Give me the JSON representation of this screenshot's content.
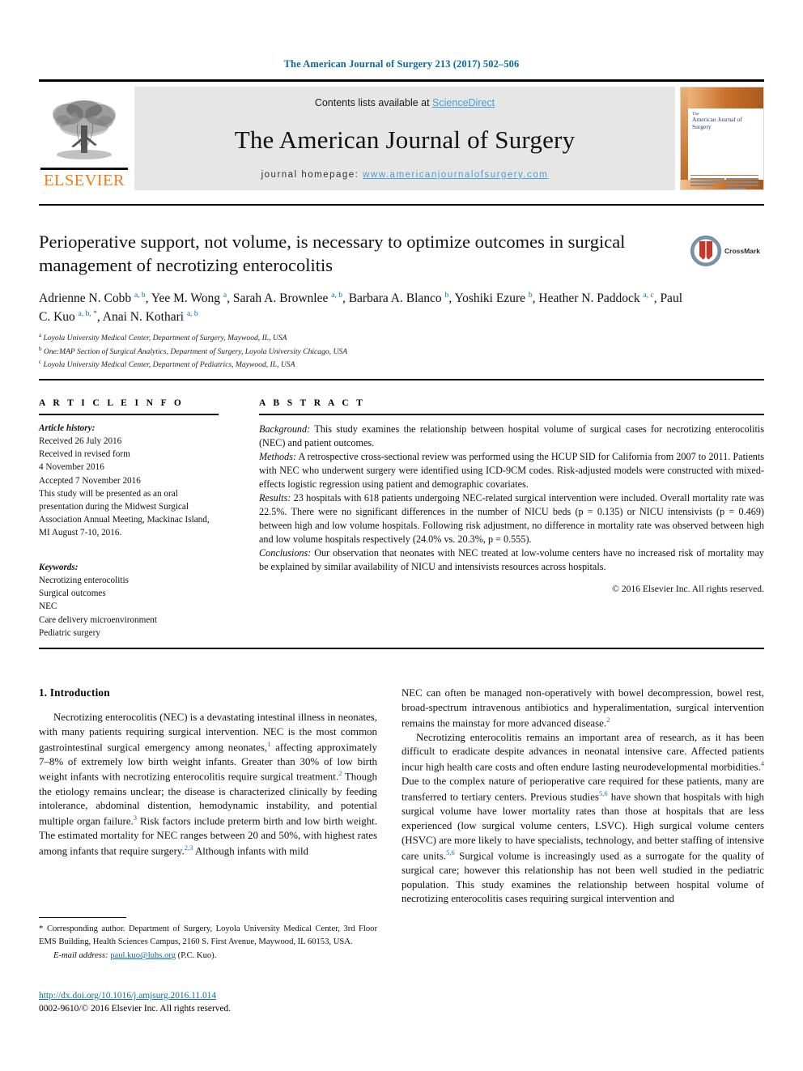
{
  "running_head": "The American Journal of Surgery 213 (2017) 502–506",
  "masthead": {
    "publisher": "ELSEVIER",
    "contents_prefix": "Contents lists available at ",
    "contents_link": "ScienceDirect",
    "journal_title": "The American Journal of Surgery",
    "homepage_prefix": "journal homepage: ",
    "homepage_url": "www.americanjournalofsurgery.com",
    "cover_title_small": "The",
    "cover_title": "American Journal of Surgery"
  },
  "article": {
    "title": "Perioperative support, not volume, is necessary to optimize outcomes in surgical management of necrotizing enterocolitis",
    "authors_html": "Adrienne N. Cobb <sup>a, b</sup>, Yee M. Wong <sup>a</sup>, Sarah A. Brownlee <sup>a, b</sup>, Barbara A. Blanco <sup>b</sup>, Yoshiki Ezure <sup>b</sup>, Heather N. Paddock <sup>a, c</sup>, Paul C. Kuo <sup>a, b, *</sup>, Anai N. Kothari <sup>a, b</sup>",
    "affiliations": [
      {
        "marker": "a",
        "text": "Loyola University Medical Center, Department of Surgery, Maywood, IL, USA"
      },
      {
        "marker": "b",
        "text": "One:MAP Section of Surgical Analytics, Department of Surgery, Loyola University Chicago, USA"
      },
      {
        "marker": "c",
        "text": "Loyola University Medical Center, Department of Pediatrics, Maywood, IL, USA"
      }
    ],
    "crossmark_label": "CrossMark"
  },
  "article_info": {
    "heading": "A R T I C L E  I N F O",
    "history_label": "Article history:",
    "history_lines": [
      "Received 26 July 2016",
      "Received in revised form",
      "4 November 2016",
      "Accepted 7 November 2016",
      "This study will be presented as an oral presentation during the Midwest Surgical Association Annual Meeting, Mackinac Island, MI August 7-10, 2016."
    ],
    "keywords_label": "Keywords:",
    "keywords": [
      "Necrotizing enterocolitis",
      "Surgical outcomes",
      "NEC",
      "Care delivery microenvironment",
      "Pediatric surgery"
    ]
  },
  "abstract": {
    "heading": "A B S T R A C T",
    "sections": [
      {
        "label": "Background:",
        "text": " This study examines the relationship between hospital volume of surgical cases for necrotizing enterocolitis (NEC) and patient outcomes."
      },
      {
        "label": "Methods:",
        "text": " A retrospective cross-sectional review was performed using the HCUP SID for California from 2007 to 2011. Patients with NEC who underwent surgery were identified using ICD-9CM codes. Risk-adjusted models were constructed with mixed-effects logistic regression using patient and demographic covariates."
      },
      {
        "label": "Results:",
        "text": " 23 hospitals with 618 patients undergoing NEC-related surgical intervention were included. Overall mortality rate was 22.5%. There were no significant differences in the number of NICU beds (p = 0.135) or NICU intensivists (p = 0.469) between high and low volume hospitals. Following risk adjustment, no difference in mortality rate was observed between high and low volume hospitals respectively (24.0% vs. 20.3%, p = 0.555)."
      },
      {
        "label": "Conclusions:",
        "text": " Our observation that neonates with NEC treated at low-volume centers have no increased risk of mortality may be explained by similar availability of NICU and intensivists resources across hospitals."
      }
    ],
    "copyright": "© 2016 Elsevier Inc. All rights reserved."
  },
  "body": {
    "section_heading": "1. Introduction",
    "left_paragraphs_html": [
      "Necrotizing enterocolitis (NEC) is a devastating intestinal illness in neonates, with many patients requiring surgical intervention. NEC is the most common gastrointestinal surgical emergency among neonates,<sup>1</sup> affecting approximately 7–8% of extremely low birth weight infants. Greater than 30% of low birth weight infants with necrotizing enterocolitis require surgical treatment.<sup>2</sup> Though the etiology remains unclear; the disease is characterized clinically by feeding intolerance, abdominal distention, hemodynamic instability, and potential multiple organ failure.<sup>3</sup> Risk factors include preterm birth and low birth weight. The estimated mortality for NEC ranges between 20 and 50%, with highest rates among infants that require surgery.<sup>2,3</sup> Although infants with mild"
    ],
    "right_paragraphs_html": [
      "NEC can often be managed non-operatively with bowel decompression, bowel rest, broad-spectrum intravenous antibiotics and hyperalimentation, surgical intervention remains the mainstay for more advanced disease.<sup>2</sup>",
      "Necrotizing enterocolitis remains an important area of research, as it has been difficult to eradicate despite advances in neonatal intensive care. Affected patients incur high health care costs and often endure lasting neurodevelopmental morbidities.<sup>4</sup> Due to the complex nature of perioperative care required for these patients, many are transferred to tertiary centers. Previous studies<sup>5,6</sup> have shown that hospitals with high surgical volume have lower mortality rates than those at hospitals that are less experienced (low surgical volume centers, LSVC). High surgical volume centers (HSVC) are more likely to have specialists, technology, and better staffing of intensive care units.<sup>5,6</sup> Surgical volume is increasingly used as a surrogate for the quality of surgical care; however this relationship has not been well studied in the pediatric population. This study examines the relationship between hospital volume of necrotizing enterocolitis cases requiring surgical intervention and"
    ]
  },
  "footnote": {
    "star": "*",
    "text": " Corresponding author. Department of Surgery, Loyola University Medical Center, 3rd Floor EMS Building, Health Sciences Campus, 2160 S. First Avenue, Maywood, IL 60153, USA.",
    "email_label": "E-mail address:",
    "email": "paul.kuo@luhs.org",
    "email_owner": "(P.C. Kuo)."
  },
  "footer": {
    "doi": "http://dx.doi.org/10.1016/j.amjsurg.2016.11.014",
    "issn_line": "0002-9610/© 2016 Elsevier Inc. All rights reserved."
  },
  "colors": {
    "link": "#0b6ba0",
    "sciencedirect": "#4a9fd4",
    "elsevier_orange": "#ef7d1a",
    "band_gray": "#e6e6e6"
  }
}
